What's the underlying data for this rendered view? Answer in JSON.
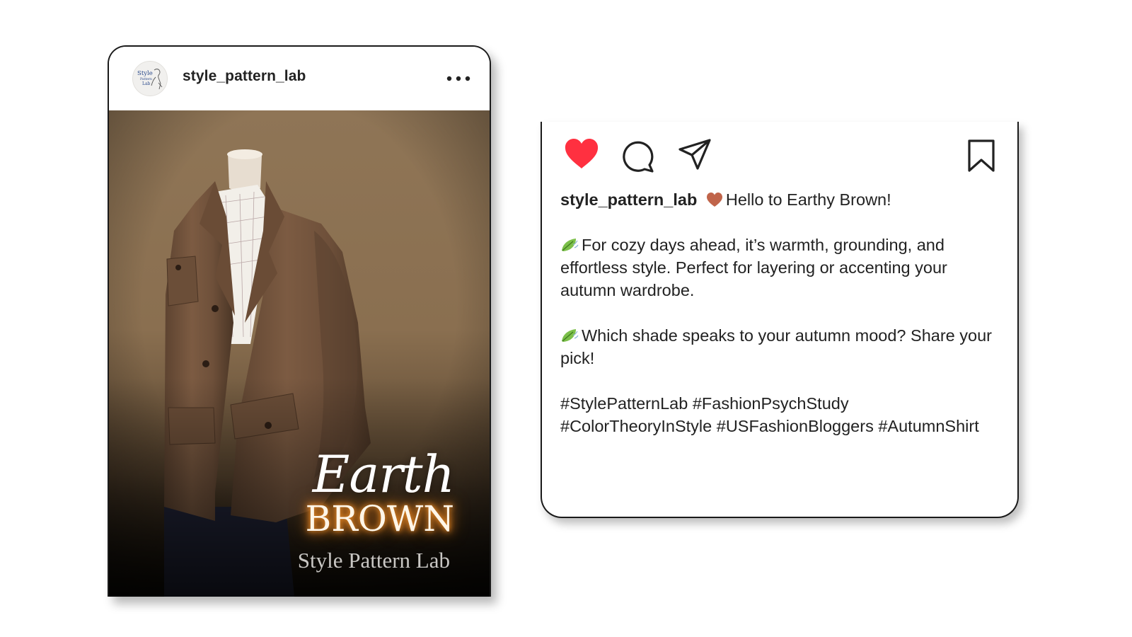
{
  "post": {
    "username": "style_pattern_lab",
    "avatar": {
      "text_line1": "Style",
      "text_line2": "Pattern",
      "text_line3": "Lab"
    },
    "more_icon": "more-horizontal-icon",
    "image": {
      "subject": "brown suede jacket on mannequin",
      "overlay_line1": "Earth",
      "overlay_line2": "BROWN",
      "overlay_brand": "Style Pattern Lab"
    }
  },
  "caption_card": {
    "actions": {
      "like_icon": "heart-filled-icon",
      "like_color": "#ff3040",
      "comment_icon": "comment-bubble-icon",
      "share_icon": "paper-plane-icon",
      "save_icon": "bookmark-icon"
    },
    "username": "style_pattern_lab",
    "heart_emoji_color": "#c0644a",
    "headline": "Hello to Earthy Brown!",
    "paragraph1": "For cozy days ahead, it’s warmth, grounding, and effortless style. Perfect for layering or accenting your autumn wardrobe.",
    "paragraph2": "Which shade speaks to your autumn mood? Share your pick!",
    "hashtags": [
      "#StylePatternLab",
      "#FashionPsychStudy",
      "#ColorTheoryInStyle",
      "#USFashionBloggers",
      "#AutumnShirt"
    ]
  }
}
